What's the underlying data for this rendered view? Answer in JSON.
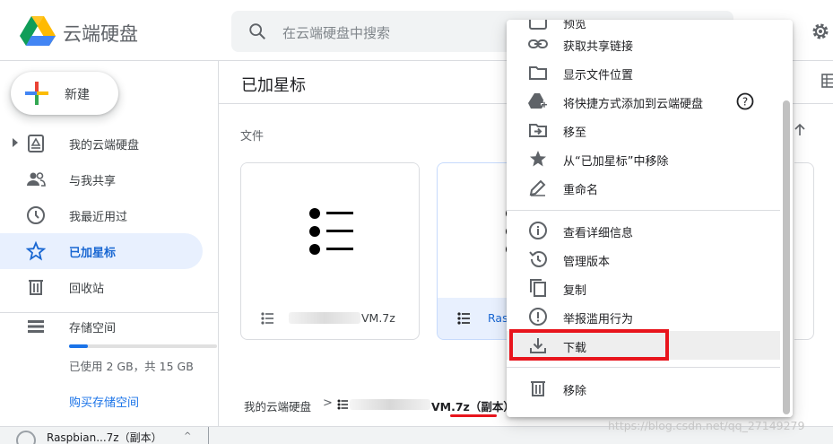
{
  "header": {
    "brand": "云端硬盘",
    "search_placeholder": "在云端硬盘中搜索"
  },
  "sidebar": {
    "new_label": "新建",
    "items": [
      {
        "label": "我的云端硬盘",
        "icon": "drive-icon"
      },
      {
        "label": "与我共享",
        "icon": "shared-icon"
      },
      {
        "label": "我最近用过",
        "icon": "clock-icon"
      },
      {
        "label": "已加星标",
        "icon": "star-icon",
        "active": true
      },
      {
        "label": "回收站",
        "icon": "trash-icon"
      }
    ],
    "storage": {
      "label": "存储空间",
      "used_text": "已使用 2 GB，共 15 GB",
      "used_fraction": 0.13,
      "buy_label": "购买存储空间"
    }
  },
  "main": {
    "title": "已加星标",
    "section_label": "文件",
    "files": [
      {
        "name": "VM.7z"
      },
      {
        "name": "Ras"
      }
    ],
    "breadcrumb": {
      "root": "我的云端硬盘",
      "separator": ">",
      "current": "VM.7z（副本）"
    }
  },
  "context_menu": {
    "items": [
      {
        "label": "预览",
        "icon": "preview-icon"
      },
      {
        "label": "获取共享链接",
        "icon": "link-icon"
      },
      {
        "label": "显示文件位置",
        "icon": "folder-icon"
      },
      {
        "label": "将快捷方式添加到云端硬盘",
        "icon": "add-shortcut-icon"
      },
      {
        "label": "移至",
        "icon": "move-icon"
      },
      {
        "label": "从“已加星标”中移除",
        "icon": "star-filled-icon"
      },
      {
        "label": "重命名",
        "icon": "pencil-icon"
      },
      {
        "label": "查看详细信息",
        "icon": "info-icon"
      },
      {
        "label": "管理版本",
        "icon": "history-icon"
      },
      {
        "label": "复制",
        "icon": "copy-icon"
      },
      {
        "label": "举报滥用行为",
        "icon": "report-icon"
      },
      {
        "label": "下载",
        "icon": "download-icon",
        "highlighted": true
      },
      {
        "label": "移除",
        "icon": "delete-icon"
      }
    ]
  },
  "bottom_bar": {
    "download_item": "Raspbian...7z（副本）"
  },
  "watermark": "https://blog.csdn.net/qq_27149279",
  "colors": {
    "accent": "#1a73e8",
    "active_bg": "#e8f0fe",
    "highlight_red": "#e8141c"
  }
}
